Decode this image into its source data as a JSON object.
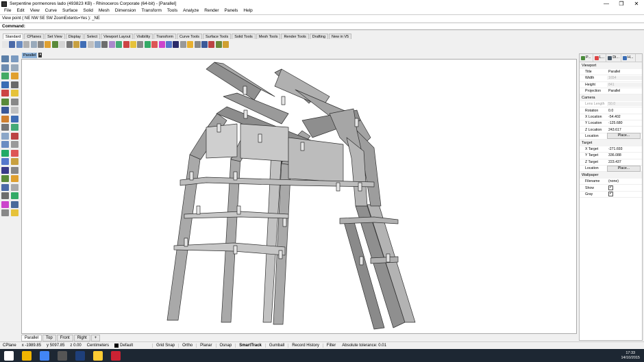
{
  "window": {
    "title": "Serpentine pormenores lado (493823 KB) - Rhinoceros Corporate (64-bit) - [Parallel]",
    "min": "—",
    "max": "❐",
    "close": "✕"
  },
  "menu": [
    "File",
    "Edit",
    "View",
    "Curve",
    "Surface",
    "Solid",
    "Mesh",
    "Dimension",
    "Transform",
    "Tools",
    "Analyze",
    "Render",
    "Panels",
    "Help"
  ],
  "history": "View point ( NE  NW  SE  SW  ZoomExtents=Yes ): _NE",
  "command": "Command:",
  "tabs": [
    "Standard",
    "CPlanes",
    "Set View",
    "Display",
    "Select",
    "Viewport Layout",
    "Visibility",
    "Transform",
    "Curve Tools",
    "Surface Tools",
    "Solid Tools",
    "Mesh Tools",
    "Render Tools",
    "Drafting",
    "New in V5"
  ],
  "toolbar_colors": [
    "#e6e6e6",
    "#4b6aa8",
    "#6a8cc2",
    "#b0b0b0",
    "#9ab",
    "#888",
    "#e0a030",
    "#5a8a3a",
    "#d4d4d4",
    "#777",
    "#c8a040",
    "#3f6db5",
    "#c0c0c0",
    "#8aa6c8",
    "#6d6d6d",
    "#a8c",
    "#4a7",
    "#c44",
    "#e6c23a",
    "#888",
    "#3a6",
    "#d55",
    "#c4c",
    "#5577cc",
    "#2a2a6a",
    "#999",
    "#e8b030",
    "#888",
    "#3b5998",
    "#b44",
    "#6a8a3a",
    "#d0a030"
  ],
  "left_colors": [
    "#5b7fa8",
    "#7a9ac0",
    "#6d8cb0",
    "#9ab",
    "#4a6",
    "#e0a030",
    "#3a6db5",
    "#6a6a6a",
    "#c44",
    "#e6c23a",
    "#5a8a3a",
    "#888",
    "#3b5998",
    "#c0c0c0",
    "#d08030",
    "#3f6db5",
    "#777",
    "#4a7",
    "#8aa6c8",
    "#b44",
    "#6a8cc2",
    "#999",
    "#2a6",
    "#d55",
    "#5577cc",
    "#c8a040",
    "#3a3a8a",
    "#888",
    "#5a8a3a",
    "#e0a030",
    "#4b6aa8",
    "#aaa",
    "#6d6d6d",
    "#3a6",
    "#c4c",
    "#4a6a9a",
    "#888",
    "#e6c23a"
  ],
  "viewport": {
    "label": "Parallel",
    "menu": "▾",
    "tabs": [
      "Parallel",
      "Top",
      "Front",
      "Right",
      "+"
    ]
  },
  "panel": {
    "tabs": [
      "P...",
      "L...",
      "Di...",
      "H..."
    ],
    "viewport_header": "Viewport",
    "title_k": "Title",
    "title_v": "Parallel",
    "width_k": "Width",
    "width_v": "1654",
    "height_k": "Height",
    "height_v": "841",
    "projection_k": "Projection",
    "projection_v": "Parallel",
    "camera_header": "Camera",
    "lens_k": "Lens Length",
    "lens_v": "50.0",
    "rotation_k": "Rotation",
    "rotation_v": "0.0",
    "xloc_k": "X Location",
    "xloc_v": "-54.402",
    "yloc_k": "Y Location",
    "yloc_v": "-125.680",
    "zloc_k": "Z Location",
    "zloc_v": "243.617",
    "location_k": "Location",
    "place": "Place...",
    "target_header": "Target",
    "xt_k": "X Target",
    "xt_v": "-271.693",
    "yt_k": "Y Target",
    "yt_v": "336.088",
    "zt_k": "Z Target",
    "zt_v": "223.437",
    "tloc_k": "Location",
    "tplace": "Place...",
    "wallpaper_header": "Wallpaper",
    "filename_k": "Filename",
    "filename_v": "(none)",
    "show_k": "Show",
    "show_v": "✓",
    "gray_k": "Gray",
    "gray_v": "✓"
  },
  "status": {
    "cplane": "CPlane",
    "x": "x -1989.85",
    "y": "y 5097.85",
    "z": "z 0.00",
    "units": "Centimeters",
    "layer": "Default",
    "layer_color": "#000000",
    "buttons": [
      "Grid Snap",
      "Ortho",
      "Planar",
      "Osnap",
      "SmartTrack",
      "Gumball",
      "Record History",
      "Filter"
    ],
    "tolerance": "Absolute tolerance: 0.01"
  },
  "clock": {
    "time": "17:33",
    "date": "14/10/2015"
  },
  "taskbar_colors": [
    "#ffffff",
    "#f0b400",
    "#4285f4",
    "#555555",
    "#1e3f7a",
    "#ffcc33",
    "#cc2233"
  ]
}
